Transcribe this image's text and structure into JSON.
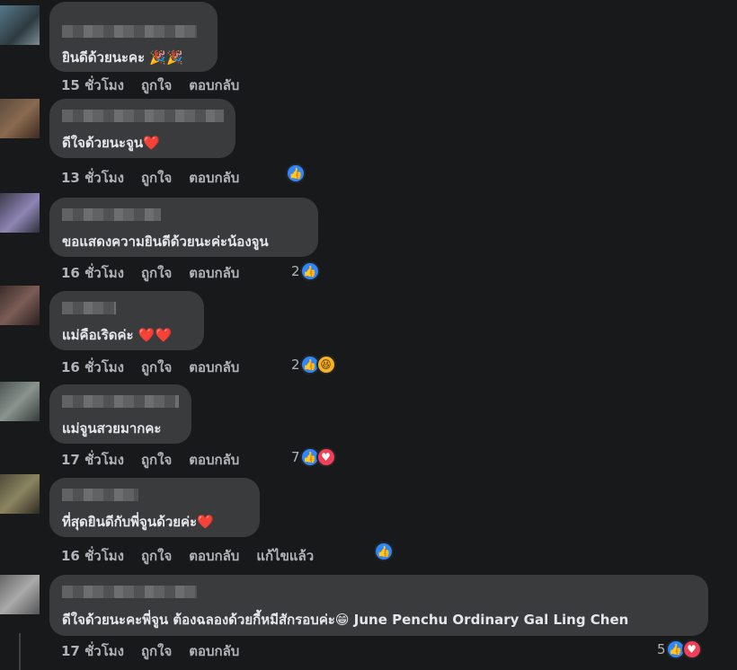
{
  "comments": [
    {
      "text": "ยินดีด้วยนะคะ 🎉🎉",
      "meta": [
        "15 ชั่วโมง",
        "ถูกใจ",
        "ตอบกลับ"
      ],
      "reaction_count": "",
      "reactions": []
    },
    {
      "text": "ดีใจด้วยนะจูน❤️",
      "meta": [
        "13 ชั่วโมง",
        "ถูกใจ",
        "ตอบกลับ"
      ],
      "reaction_count": "",
      "reactions": [
        "like-icon"
      ]
    },
    {
      "text": "ขอแสดงความยินดีด้วยนะค่ะน้องจูน",
      "meta": [
        "16 ชั่วโมง",
        "ถูกใจ",
        "ตอบกลับ"
      ],
      "reaction_count": "2",
      "reactions": [
        "like-icon"
      ]
    },
    {
      "text": "แม่คือเริดค่ะ ❤️❤️",
      "meta": [
        "16 ชั่วโมง",
        "ถูกใจ",
        "ตอบกลับ"
      ],
      "reaction_count": "2",
      "reactions": [
        "like-icon",
        "haha-icon"
      ]
    },
    {
      "text": "แม่จูนสวยมากคะ",
      "meta": [
        "17 ชั่วโมง",
        "ถูกใจ",
        "ตอบกลับ"
      ],
      "reaction_count": "7",
      "reactions": [
        "like-icon",
        "love-icon"
      ]
    },
    {
      "text": "ที่สุดยินดีกับพี่จูนด้วยค่ะ❤️",
      "meta": [
        "16 ชั่วโมง",
        "ถูกใจ",
        "ตอบกลับ",
        "แก้ไขแล้ว"
      ],
      "reaction_count": "",
      "reactions": [
        "like-icon"
      ]
    },
    {
      "text": "ดีใจด้วยนะคะพี่จูน ต้องฉลองด้วยกี้หมีสักรอบค่ะ😁 June Penchu Ordinary Gal Ling Chen",
      "meta": [
        "17 ชั่วโมง",
        "ถูกใจ",
        "ตอบกลับ"
      ],
      "reaction_count": "5",
      "reactions": [
        "like-icon",
        "love-icon"
      ]
    }
  ],
  "colors": {
    "background": "#18191a",
    "bubble": "#3a3b3c",
    "text": "#e4e6eb",
    "meta": "#b0b3b8",
    "like": "#2d88ff",
    "love": "#f33e58"
  }
}
